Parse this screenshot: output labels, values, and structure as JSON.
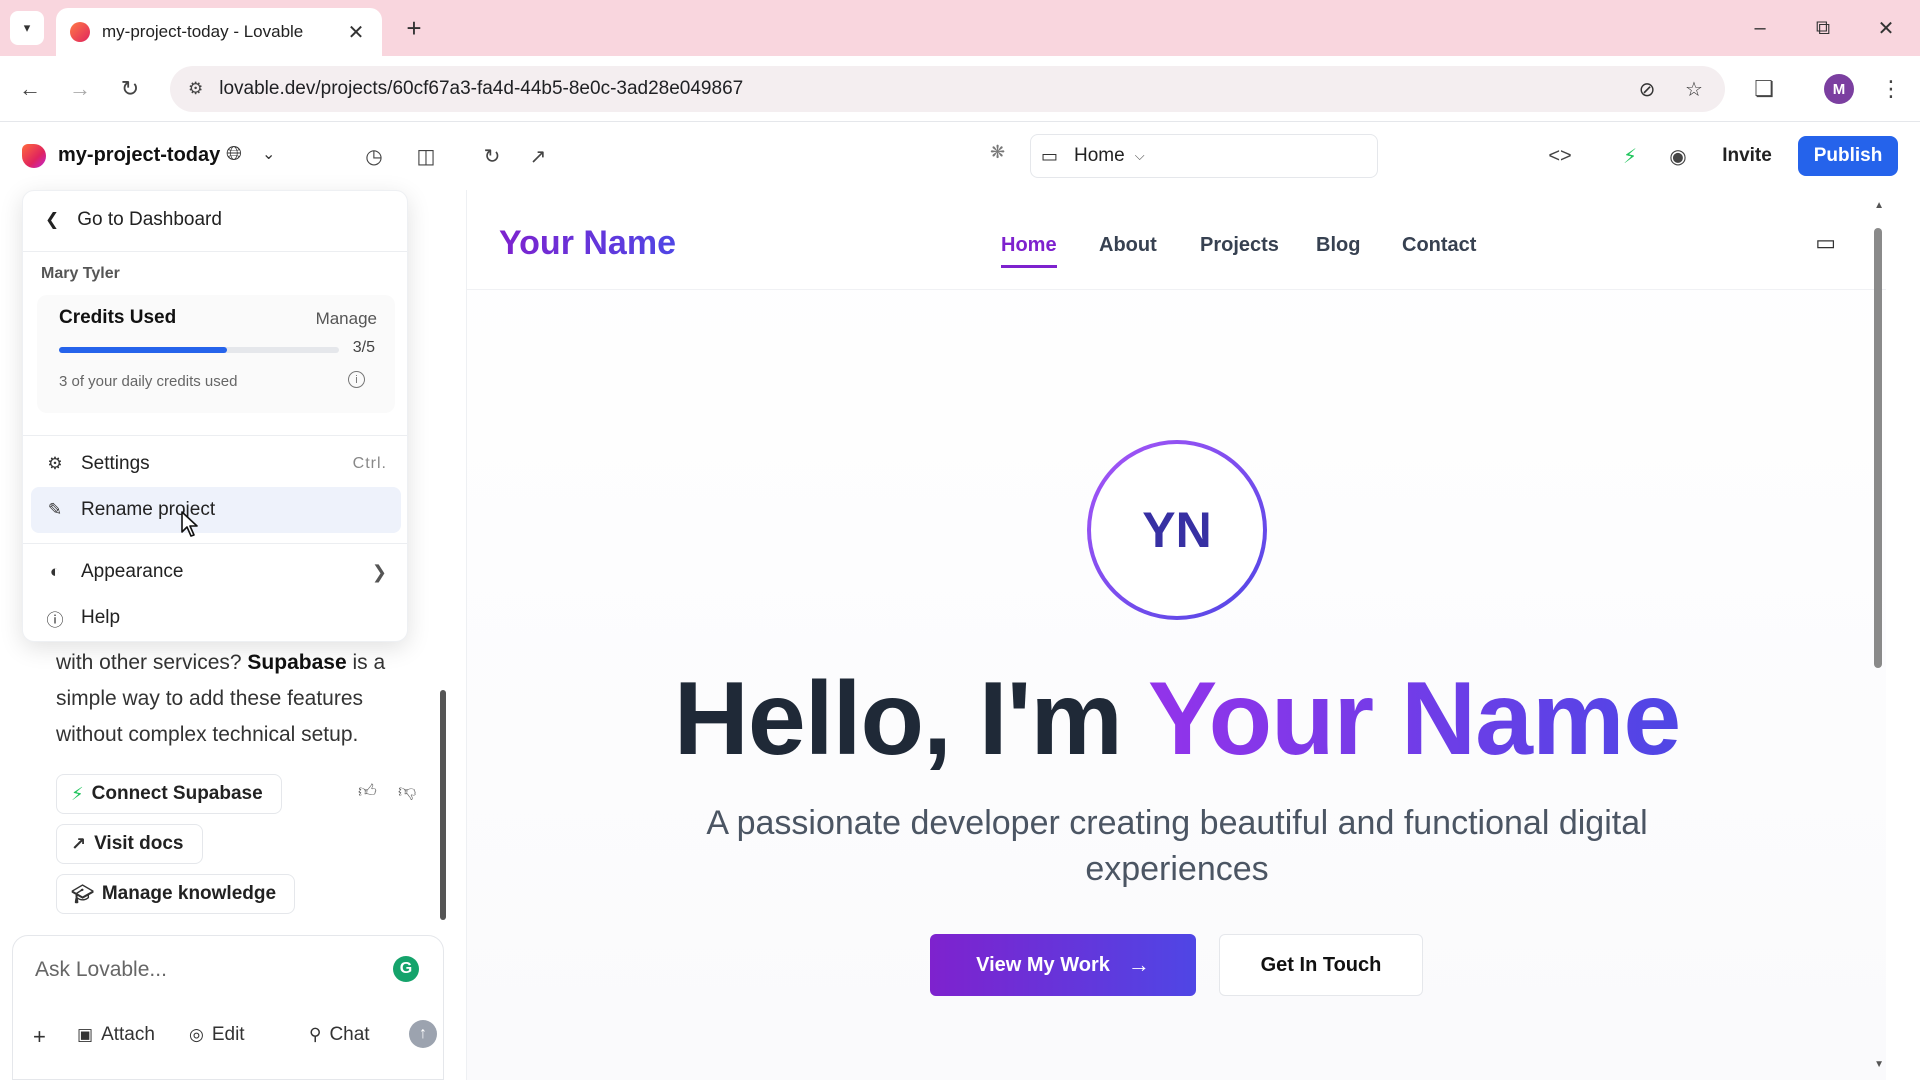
{
  "browser": {
    "tab_title": "my-project-today - Lovable",
    "url": "lovable.dev/projects/60cf67a3-fa4d-44b5-8e0c-3ad28e049867",
    "profile_initial": "M"
  },
  "toolbar": {
    "project_name": "my-project-today",
    "route": "Home",
    "invite_label": "Invite",
    "publish_label": "Publish"
  },
  "menu": {
    "back_label": "Go to Dashboard",
    "user_name": "Mary Tyler",
    "credits": {
      "title": "Credits Used",
      "manage_label": "Manage",
      "used": 3,
      "total": 5,
      "count_text": "3/5",
      "fraction": 0.6,
      "note": "3 of your daily credits used"
    },
    "items": [
      {
        "label": "Settings",
        "icon": "gear-icon",
        "shortcut": "Ctrl."
      },
      {
        "label": "Rename project",
        "icon": "edit-icon"
      },
      {
        "label": "Appearance",
        "icon": "contrast-icon"
      },
      {
        "label": "Help",
        "icon": "help-icon"
      }
    ]
  },
  "chat": {
    "text_part1": "with other services? ",
    "text_bold": "Supabase",
    "text_part2": " is a simple way to add these features without complex technical setup.",
    "actions": {
      "connect_label": "Connect Supabase",
      "docs_label": "Visit docs",
      "knowledge_label": "Manage knowledge"
    },
    "input_placeholder": "Ask Lovable...",
    "attach_label": "Attach",
    "edit_label": "Edit",
    "chat_label": "Chat"
  },
  "preview": {
    "logo": "Your Name",
    "nav": [
      "Home",
      "About",
      "Projects",
      "Blog",
      "Contact"
    ],
    "avatar_initials": "YN",
    "hero_prefix": "Hello, I'm ",
    "hero_name": "Your Name",
    "subtitle": "A passionate developer creating beautiful and functional digital experiences",
    "cta_primary": "View My Work",
    "cta_secondary": "Get In Touch"
  },
  "colors": {
    "accent_blue": "#2563eb",
    "brand_purple": "#7e22ce",
    "brand_indigo": "#4f46e5",
    "tabbar_pink": "#f9d6de"
  }
}
